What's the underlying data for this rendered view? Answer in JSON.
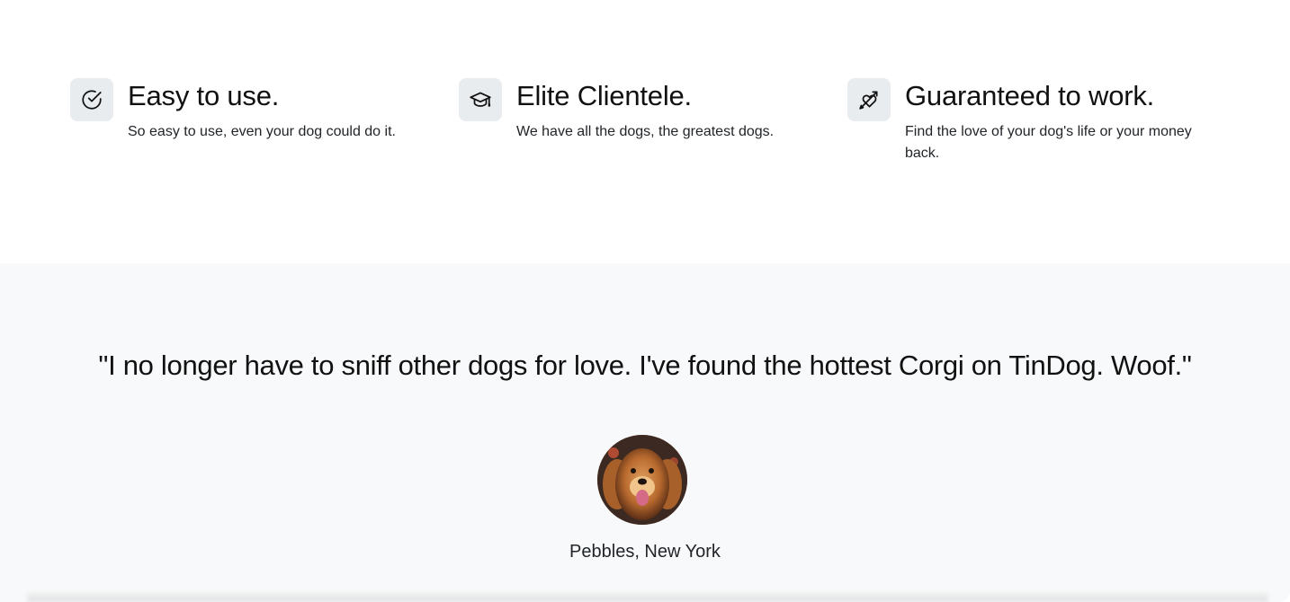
{
  "features": [
    {
      "icon": "check-circle-icon",
      "title": "Easy to use.",
      "text": "So easy to use, even your dog could do it."
    },
    {
      "icon": "graduation-cap-icon",
      "title": "Elite Clientele.",
      "text": "We have all the dogs, the greatest dogs."
    },
    {
      "icon": "heart-arrow-icon",
      "title": "Guaranteed to work.",
      "text": "Find the love of your dog's life or your money back."
    }
  ],
  "testimonial": {
    "quote": "\"I no longer have to sniff other dogs for love. I've found the hottest Corgi on TinDog. Woof.\"",
    "author": "Pebbles, New York",
    "avatar_icon": "dog-photo"
  },
  "colors": {
    "icon_bg": "#e9ecef",
    "section_bg": "#f8f9fa",
    "text": "#212529"
  }
}
